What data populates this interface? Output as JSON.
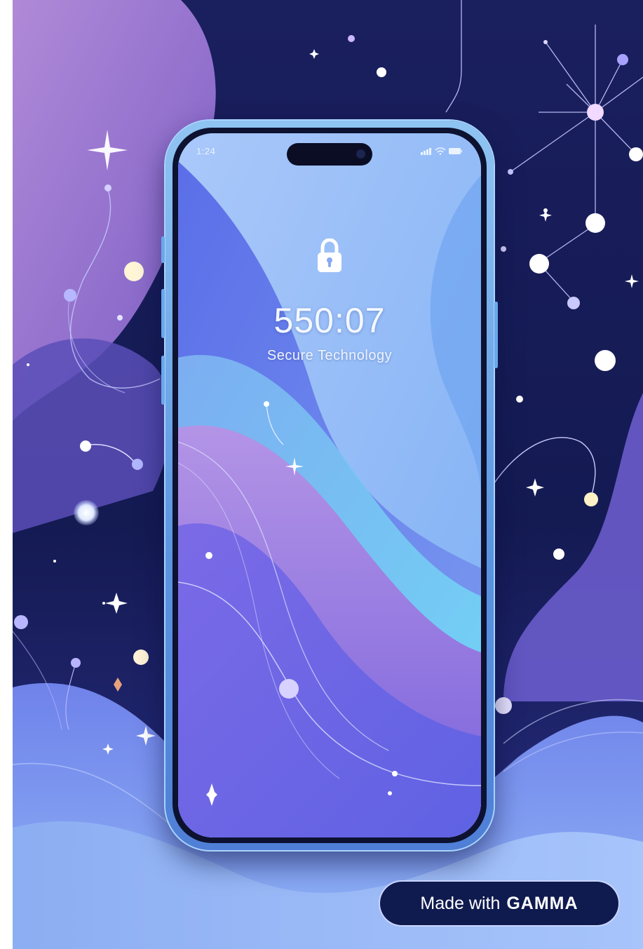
{
  "status_bar": {
    "time": "1:24"
  },
  "lock_screen": {
    "time": "550:07",
    "subtitle": "Secure Technology"
  },
  "badge": {
    "prefix": "Made with",
    "brand": "GAMMA"
  },
  "icons": [
    "lock-icon",
    "signal-icon",
    "wifi-icon",
    "battery-icon",
    "sparkle-icon"
  ],
  "colors": {
    "night_sky": "#141a52",
    "lavender": "#a07ad0",
    "periwinkle": "#7a8ef0",
    "cyan": "#6fdcf5",
    "badge": "#0f1a4f"
  }
}
